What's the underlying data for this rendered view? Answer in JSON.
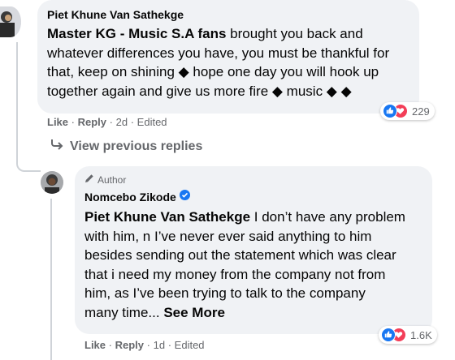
{
  "comment1": {
    "author": "Piet Khune Van Sathekge",
    "mention": "Master KG - Music S.A fans",
    "text_line1_rest": " brought you back and",
    "text_line2": "whatever differences you have, you must be thankful for",
    "text_line3": "that, keep on shining ◆ hope one day you will hook up",
    "text_line4": "together again and give us more fire ◆ music ◆ ◆",
    "like_label": "Like",
    "reply_label": "Reply",
    "time": "2d",
    "edited": "Edited",
    "reaction_count": "229"
  },
  "view_previous_replies": "View previous replies",
  "comment2": {
    "badge": "Author",
    "author": "Nomcebo Zikode",
    "mention": "Piet Khune Van Sathekge",
    "text_line1_rest": " I don’t have any problem",
    "text_line2": "with him, n I’ve never ever said anything to him",
    "text_line3": "besides sending out the statement which was clear",
    "text_line4": "that i need my money from the company not from",
    "text_line5": "him, as I’ve been trying to talk to the company",
    "text_line6_start": "many time...",
    "see_more": "See More",
    "like_label": "Like",
    "reply_label": "Reply",
    "time": "1d",
    "edited": "Edited",
    "reaction_count": "1.6K"
  },
  "colors": {
    "like": "#1877f2",
    "love": "#f33e58",
    "bubble": "#f0f2f5",
    "meta": "#65676b",
    "verified": "#1877f2"
  }
}
